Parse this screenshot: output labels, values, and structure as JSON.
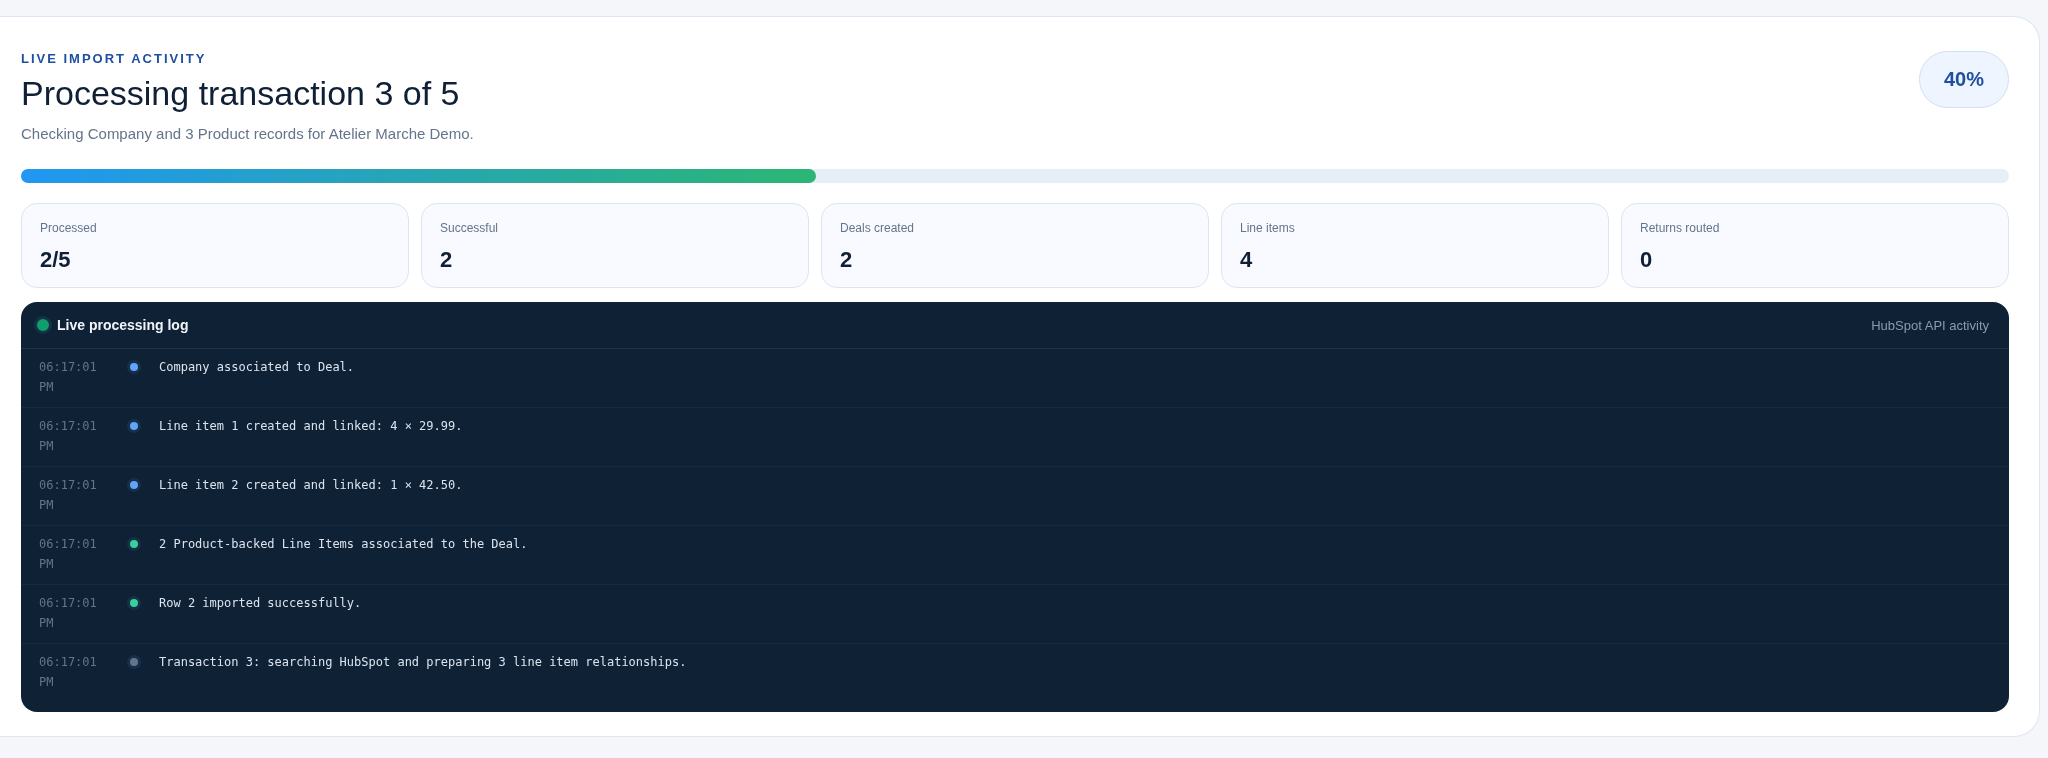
{
  "kicker": "LIVE IMPORT ACTIVITY",
  "title": "Processing transaction 3 of 5",
  "subtitle": "Checking Company and 3 Product records for Atelier Marche Demo.",
  "percent": "40%",
  "progress": {
    "level": 0.4
  },
  "stats": [
    {
      "label": "Processed",
      "value": "2/5"
    },
    {
      "label": "Successful",
      "value": "2"
    },
    {
      "label": "Deals created",
      "value": "2"
    },
    {
      "label": "Line items",
      "value": "4"
    },
    {
      "label": "Returns routed",
      "value": "0"
    }
  ],
  "log": {
    "title": "Live processing log",
    "caption": "HubSpot API activity",
    "entries": [
      {
        "time": "06:17:01 PM",
        "message": "Company associated to Deal.",
        "color": "#60a5fa"
      },
      {
        "time": "06:17:01 PM",
        "message": "Line item 1 created and linked: 4 × 29.99.",
        "color": "#60a5fa"
      },
      {
        "time": "06:17:01 PM",
        "message": "Line item 2 created and linked: 1 × 42.50.",
        "color": "#60a5fa"
      },
      {
        "time": "06:17:01 PM",
        "message": "2 Product-backed Line Items associated to the Deal.",
        "color": "#34d399"
      },
      {
        "time": "06:17:01 PM",
        "message": "Row 2 imported successfully.",
        "color": "#34d399"
      },
      {
        "time": "06:17:01 PM",
        "message": "Transaction 3: searching HubSpot and preparing 3 line item relationships.",
        "color": "#64748b"
      }
    ]
  }
}
